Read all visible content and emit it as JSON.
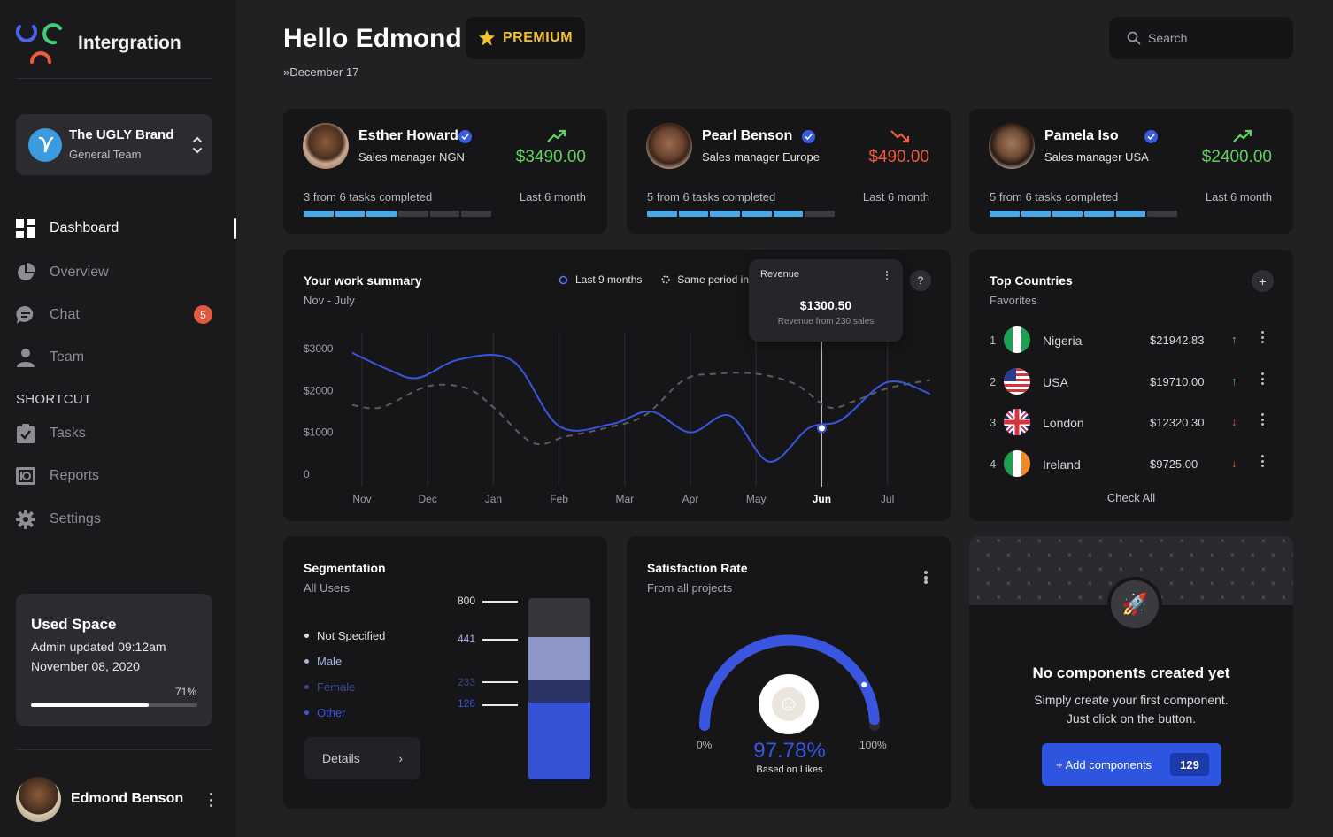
{
  "app": {
    "name": "Intergration"
  },
  "brand": {
    "name": "The UGLY Brand",
    "team": "General Team"
  },
  "nav": {
    "items": [
      {
        "label": "Dashboard",
        "icon": "grid-icon",
        "active": true
      },
      {
        "label": "Overview",
        "icon": "pie-icon"
      },
      {
        "label": "Chat",
        "icon": "chat-icon",
        "badge": "5"
      },
      {
        "label": "Team",
        "icon": "person-icon"
      }
    ],
    "shortcut_heading": "SHORTCUT",
    "shortcuts": [
      {
        "label": "Tasks",
        "icon": "clipboard-check-icon"
      },
      {
        "label": "Reports",
        "icon": "report-icon"
      },
      {
        "label": "Settings",
        "icon": "gear-icon"
      }
    ]
  },
  "used_space": {
    "title": "Used Space",
    "line1": "Admin updated 09:12am",
    "line2": "November 08, 2020",
    "percent_label": "71%",
    "percent": 0.71
  },
  "user": {
    "name": "Edmond Benson"
  },
  "header": {
    "greeting": "Hello Edmond",
    "badge": "PREMIUM",
    "date": "December 17",
    "search_placeholder": "Search"
  },
  "managers": [
    {
      "name": "Esther Howard",
      "role": "Sales manager NGN",
      "amount": "$3490.00",
      "trend": "up",
      "tasks": "3 from 6 tasks completed",
      "period": "Last 6 month",
      "completed": 3,
      "total": 6
    },
    {
      "name": "Pearl Benson",
      "role": "Sales manager Europe",
      "amount": "$490.00",
      "trend": "down",
      "tasks": "5 from 6 tasks completed",
      "period": "Last 6 month",
      "completed": 5,
      "total": 6
    },
    {
      "name": "Pamela Iso",
      "role": "Sales manager USA",
      "amount": "$2400.00",
      "trend": "up",
      "tasks": "5 from 6 tasks completed",
      "period": "Last 6 month",
      "completed": 5,
      "total": 6
    }
  ],
  "colors": {
    "accent": "#3a55df",
    "positive": "#5fd35f",
    "negative": "#ef5a3c",
    "premium": "#f3c42f",
    "progress": "#4aa8e8"
  },
  "work_summary": {
    "title": "Your work summary",
    "subtitle": "Nov - July",
    "legend_current": "Last 9 months",
    "legend_previous": "Same period in",
    "tooltip": {
      "label": "Revenue",
      "value": "$1300.50",
      "note": "Revenue from 230 sales"
    },
    "help": "?"
  },
  "chart_data": {
    "type": "line",
    "categories": [
      "Nov",
      "Dec",
      "Jan",
      "Feb",
      "Mar",
      "Apr",
      "May",
      "Jun",
      "Jul"
    ],
    "y_ticks": [
      "$3000",
      "$2000",
      "$1000",
      "0"
    ],
    "ylim": [
      0,
      3000
    ],
    "grid": "vertical",
    "highlight": "Jun",
    "series": [
      {
        "name": "Last 9 months",
        "style": "solid",
        "color": "#3a55df",
        "x": [
          -0.15,
          0.4,
          0.85,
          1.5,
          2.3,
          3.0,
          3.8,
          4.4,
          5.0,
          5.6,
          6.2,
          6.8,
          7.3,
          8.0,
          8.65
        ],
        "y": [
          2900,
          2500,
          2300,
          2750,
          2700,
          1150,
          1200,
          1500,
          1000,
          1400,
          300,
          1100,
          1300,
          2200,
          1920
        ]
      },
      {
        "name": "Same period in",
        "style": "dashed",
        "color": "#5b5b60",
        "x": [
          -0.15,
          0.3,
          1.0,
          1.6,
          2.0,
          2.6,
          3.1,
          3.7,
          4.3,
          4.9,
          5.4,
          6.0,
          6.6,
          7.1,
          7.5,
          8.0,
          8.65
        ],
        "y": [
          1650,
          1600,
          2100,
          2050,
          1600,
          750,
          900,
          1100,
          1400,
          2250,
          2400,
          2400,
          2150,
          1600,
          1750,
          2050,
          2250
        ]
      }
    ]
  },
  "top_countries": {
    "title": "Top Countries",
    "subtitle": "Favorites",
    "rows": [
      {
        "rank": "1",
        "name": "Nigeria",
        "value": "$21942.83",
        "trend": "up",
        "flag": "nigeria-flag-icon"
      },
      {
        "rank": "2",
        "name": "USA",
        "value": "$19710.00",
        "trend": "up",
        "flag": "usa-flag-icon"
      },
      {
        "rank": "3",
        "name": "London",
        "value": "$12320.30",
        "trend": "down",
        "flag": "uk-flag-icon"
      },
      {
        "rank": "4",
        "name": "Ireland",
        "value": "$9725.00",
        "trend": "down",
        "flag": "ireland-flag-icon"
      }
    ],
    "check_all": "Check All"
  },
  "segmentation": {
    "title": "Segmentation",
    "subtitle": "All Users",
    "items": [
      {
        "label": "Not Specified",
        "value": "800",
        "color": "#e0e0e3"
      },
      {
        "label": "Male",
        "value": "441",
        "color": "#a7b3ea"
      },
      {
        "label": "Female",
        "value": "233",
        "color": "#3a4a8a"
      },
      {
        "label": "Other",
        "value": "126",
        "color": "#3a55df"
      }
    ],
    "details": "Details"
  },
  "satisfaction": {
    "title": "Satisfaction Rate",
    "subtitle": "From all projects",
    "min_label": "0%",
    "max_label": "100%",
    "value_label": "97.78%",
    "value": 0.9778,
    "caption": "Based on Likes"
  },
  "empty_state": {
    "title": "No components created yet",
    "line1": "Simply create your first component.",
    "line2": "Just click on the button.",
    "button": "+ Add components",
    "count": "129"
  }
}
